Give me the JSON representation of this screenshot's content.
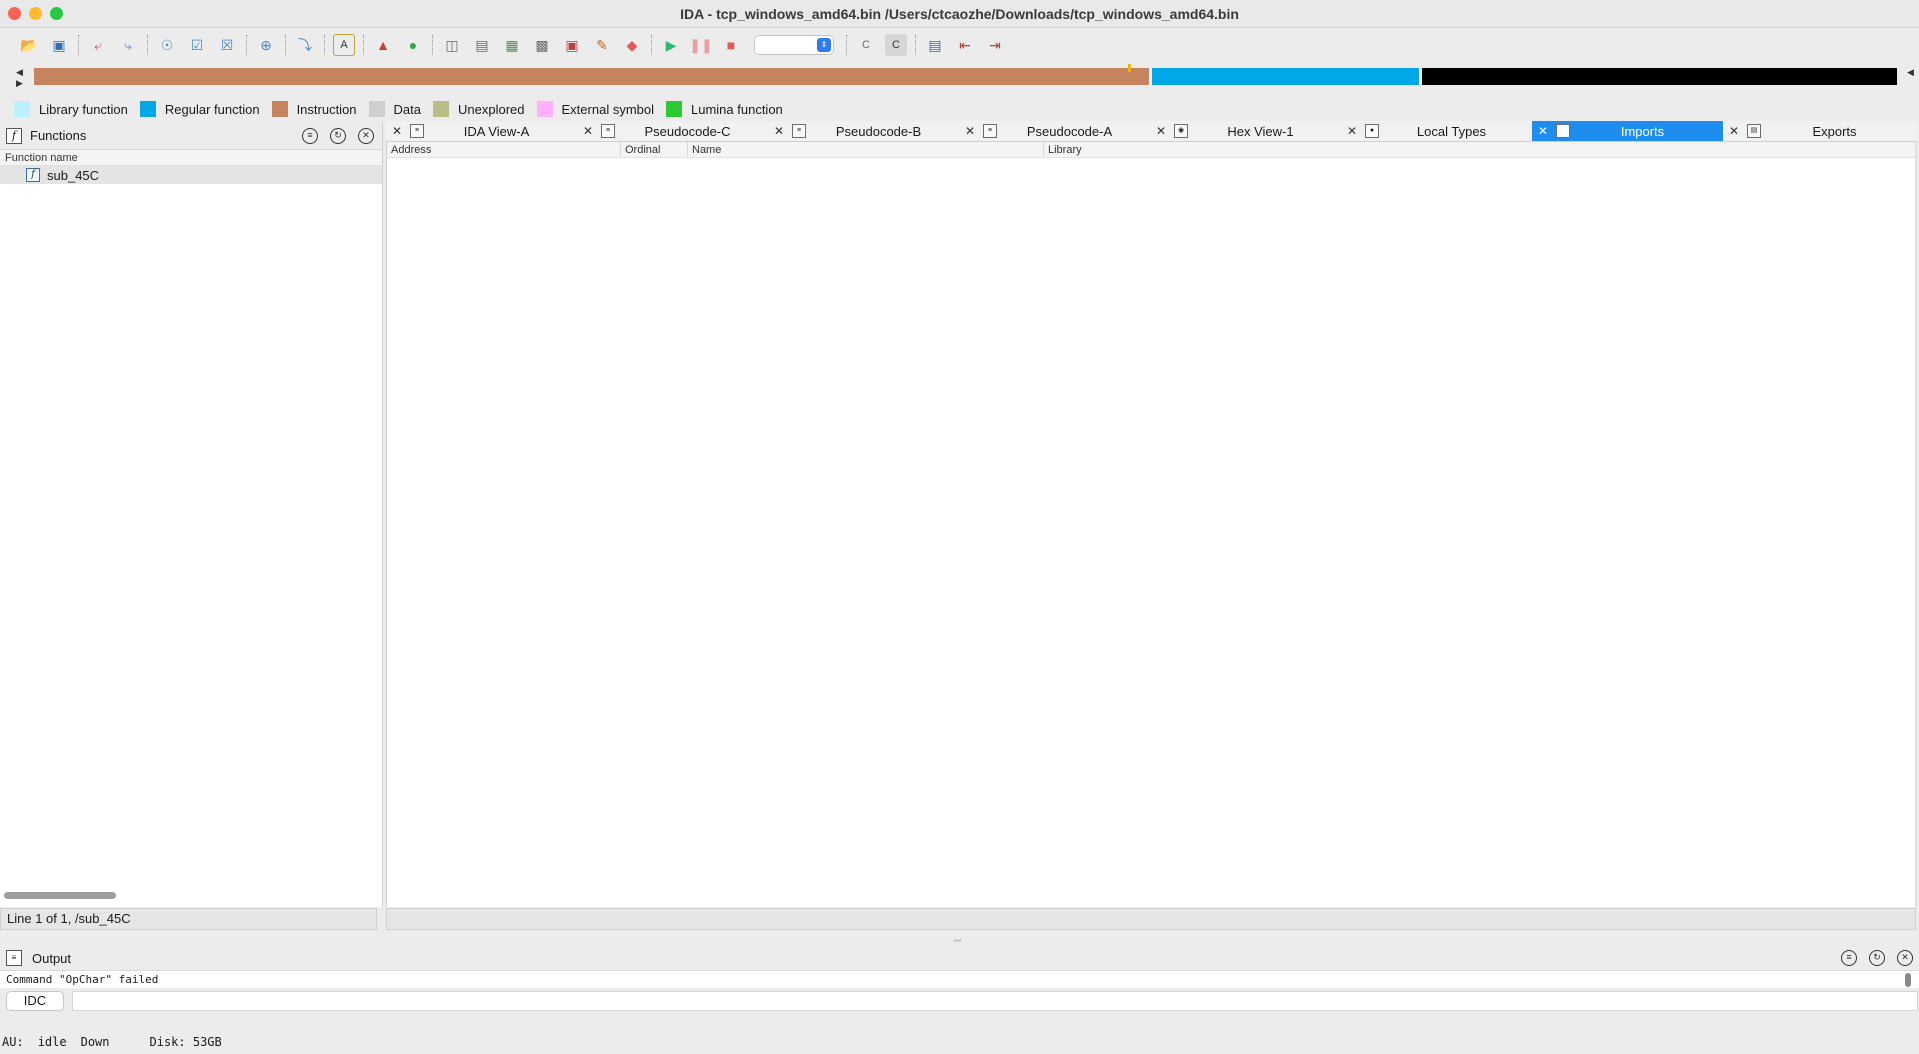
{
  "window": {
    "title": "IDA - tcp_windows_amd64.bin /Users/ctcaozhe/Downloads/tcp_windows_amd64.bin",
    "lights": [
      "#ff5f57",
      "#febc2e",
      "#28c840"
    ]
  },
  "toolbar": {
    "icons": [
      "open-icon",
      "save-icon",
      "jump-back-icon",
      "jump-forward-icon",
      "search-icon",
      "search-text-icon",
      "search-binary-icon",
      "add-icon",
      "next-icon",
      "text-icon",
      "graph-icon",
      "run-icon",
      "segments-icon",
      "list-icon",
      "struct-icon",
      "patch-icon",
      "edit-icon",
      "breakpoint-icon",
      "start-icon",
      "pause-icon",
      "stop-icon",
      "code-icon",
      "code-mode-icon",
      "window-icon",
      "indent-icon",
      "outdent-icon"
    ],
    "debugger_select": ""
  },
  "navband": {
    "colors": {
      "instruction": "#c5845e",
      "regular": "#00a8e8",
      "unexplored": "#000000"
    },
    "segments": [
      {
        "type": "instruction",
        "fraction": 0.6
      },
      {
        "type": "regular",
        "fraction": 0.145
      },
      {
        "type": "unexplored",
        "fraction": 0.255
      }
    ]
  },
  "legend": [
    {
      "label": "Library function",
      "color": "#b8f2ff"
    },
    {
      "label": "Regular function",
      "color": "#00a8e8"
    },
    {
      "label": "Instruction",
      "color": "#c5845e"
    },
    {
      "label": "Data",
      "color": "#cfcfcf"
    },
    {
      "label": "Unexplored",
      "color": "#bcbc86"
    },
    {
      "label": "External symbol",
      "color": "#ffb0ff"
    },
    {
      "label": "Lumina function",
      "color": "#2ec832"
    }
  ],
  "functions_panel": {
    "title": "Functions",
    "column": "Function name",
    "items": [
      "sub_45C"
    ],
    "status": "Line 1 of 1, /sub_45C"
  },
  "tabs": [
    {
      "label": "IDA View-A",
      "active": false,
      "icon": "listing-icon"
    },
    {
      "label": "Pseudocode-C",
      "active": false,
      "icon": "pseudocode-icon"
    },
    {
      "label": "Pseudocode-B",
      "active": false,
      "icon": "pseudocode-icon"
    },
    {
      "label": "Pseudocode-A",
      "active": false,
      "icon": "pseudocode-icon"
    },
    {
      "label": "Hex View-1",
      "active": false,
      "icon": "hex-icon"
    },
    {
      "label": "Local Types",
      "active": false,
      "icon": "types-icon"
    },
    {
      "label": "Imports",
      "active": true,
      "icon": "imports-icon"
    },
    {
      "label": "Exports",
      "active": false,
      "icon": "exports-icon"
    }
  ],
  "imports_table": {
    "columns": [
      "Address",
      "Ordinal",
      "Name",
      "Library"
    ],
    "rows": []
  },
  "output": {
    "title": "Output",
    "text": "Command \"OpChar\" failed",
    "idc_label": "IDC",
    "input_value": ""
  },
  "status": {
    "au_label": "AU:",
    "au_state": "idle",
    "direction": "Down",
    "disk": "Disk: 53GB"
  }
}
